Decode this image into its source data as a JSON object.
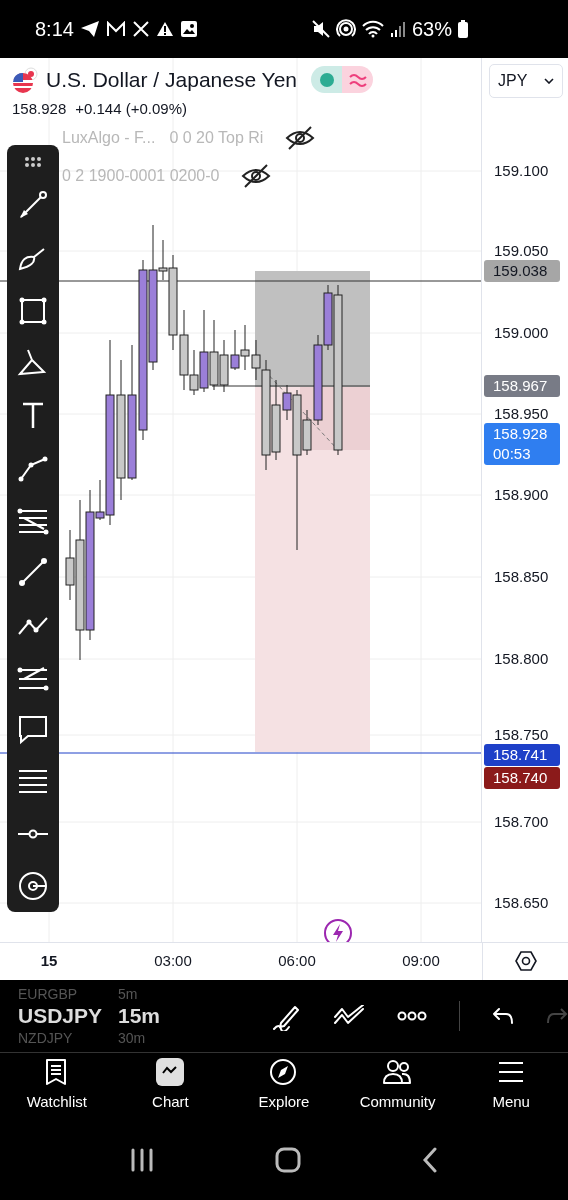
{
  "status_bar": {
    "time": "8:14",
    "battery": "63%"
  },
  "header": {
    "title": "U.S. Dollar / Japanese Yen",
    "price": "158.928",
    "change": "+0.144 (+0.09%)",
    "currency": "JPY"
  },
  "indicators": [
    {
      "texts": [
        "LuxAlgo - F...",
        "0 0 20 Top Ri"
      ],
      "hidden": true
    },
    {
      "texts": [
        "0 2 1900-0001 0200-0"
      ],
      "hidden": true
    }
  ],
  "price_axis": [
    {
      "text": "159.100",
      "kind": "tick"
    },
    {
      "text": "159.050",
      "kind": "tick"
    },
    {
      "text": "159.038",
      "kind": "badge-light",
      "color": "#a6a6a6"
    },
    {
      "text": "159.000",
      "kind": "tick"
    },
    {
      "text": "158.967",
      "kind": "badge",
      "color": "#787b86"
    },
    {
      "text": "158.950",
      "kind": "tick"
    },
    {
      "text": "158.928",
      "subtext": "00:53",
      "kind": "badge",
      "color": "#2f7ef0"
    },
    {
      "text": "158.900",
      "kind": "tick"
    },
    {
      "text": "158.850",
      "kind": "tick"
    },
    {
      "text": "158.800",
      "kind": "tick"
    },
    {
      "text": "158.750",
      "kind": "tick"
    },
    {
      "text": "158.741",
      "kind": "badge",
      "color": "#1e40c8"
    },
    {
      "text": "158.740",
      "kind": "badge",
      "color": "#8b1a1a"
    },
    {
      "text": "158.700",
      "kind": "tick"
    },
    {
      "text": "158.650",
      "kind": "tick"
    }
  ],
  "time_axis": [
    "15",
    "03:00",
    "06:00",
    "09:00"
  ],
  "symbols": [
    {
      "symbol": "EURGBP",
      "interval": "5m",
      "selected": false
    },
    {
      "symbol": "USDJPY",
      "interval": "15m",
      "selected": true
    },
    {
      "symbol": "NZDJPY",
      "interval": "30m",
      "selected": false
    }
  ],
  "nav": [
    {
      "label": "Watchlist",
      "selected": false
    },
    {
      "label": "Chart",
      "selected": true
    },
    {
      "label": "Explore",
      "selected": false
    },
    {
      "label": "Community",
      "selected": false
    },
    {
      "label": "Menu",
      "selected": false
    }
  ]
}
